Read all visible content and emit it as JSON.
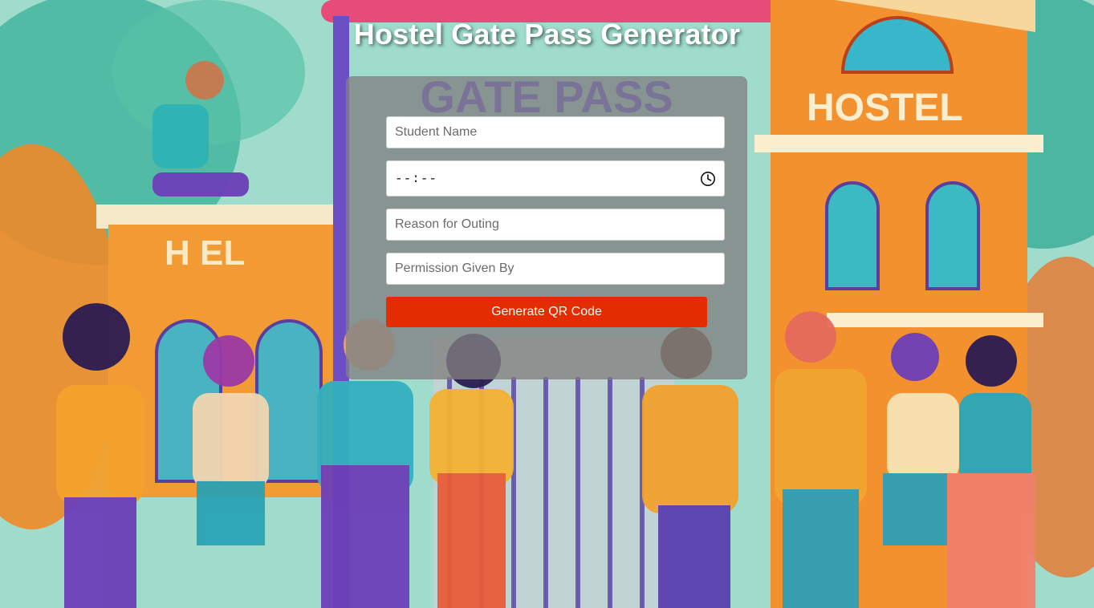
{
  "page": {
    "title": "Hostel Gate Pass Generator"
  },
  "form": {
    "student_name_placeholder": "Student Name",
    "time_value": "--:--",
    "reason_placeholder": "Reason for Outing",
    "permission_placeholder": "Permission Given By",
    "generate_label": "Generate QR Code"
  },
  "background": {
    "gate_sign_text": "GATE PASS",
    "right_building_sign": "HOSTEL",
    "left_building_sign": "H  EL"
  },
  "colors": {
    "card_bg": "#808080",
    "button_bg": "#e32d00",
    "title_color": "#ffffff"
  },
  "icons": {
    "time_picker": "clock-icon"
  }
}
